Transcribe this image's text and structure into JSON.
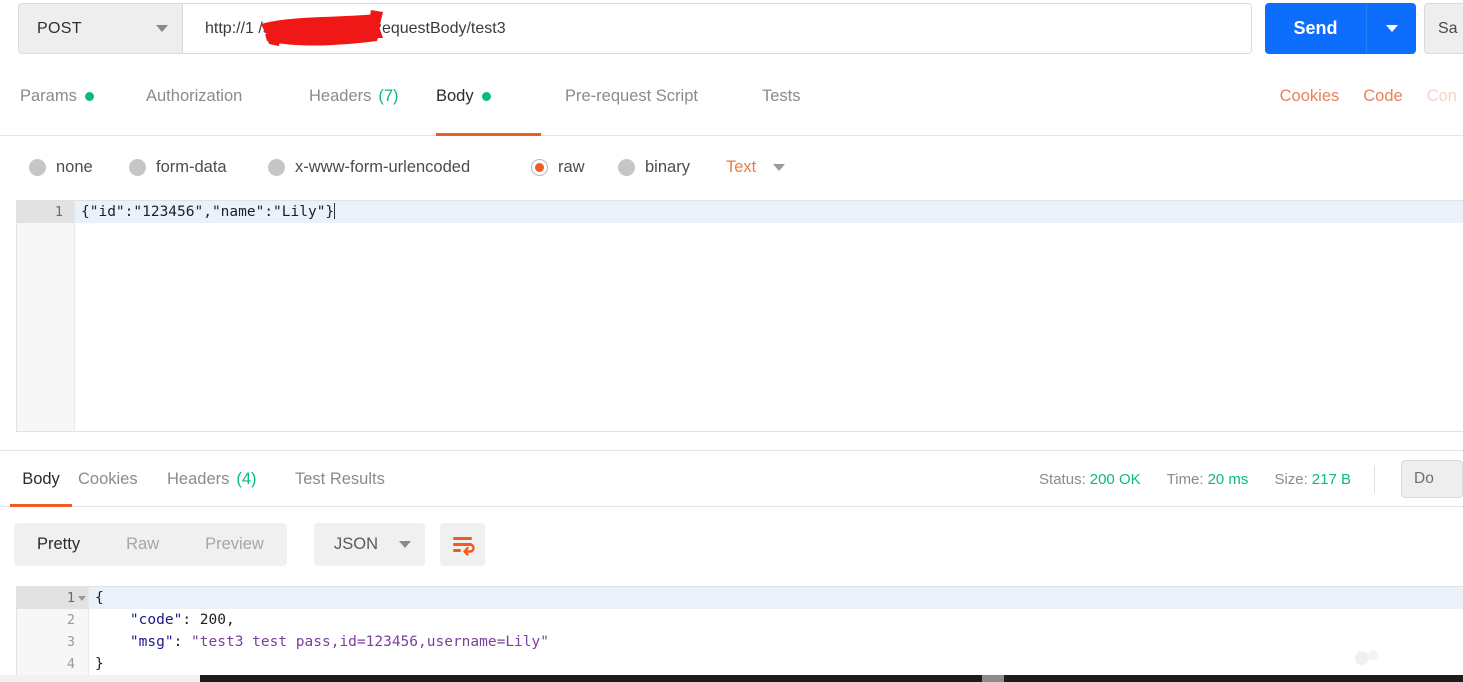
{
  "request": {
    "method": "POST",
    "url_prefix": "http://",
    "url_redacted_placeholder": "",
    "url_suffix": "/springmvc/test/RequestBody/test3",
    "url_full": "http://1          /springmvc/test/RequestBody/test3",
    "send_label": "Send",
    "save_label": "Sa",
    "tabs": [
      {
        "label": "Params",
        "dot": true,
        "count": "",
        "active": false
      },
      {
        "label": "Authorization",
        "dot": false,
        "count": "",
        "active": false
      },
      {
        "label": "Headers",
        "dot": false,
        "count": "(7)",
        "active": false
      },
      {
        "label": "Body",
        "dot": true,
        "count": "",
        "active": true
      },
      {
        "label": "Pre-request Script",
        "dot": false,
        "count": "",
        "active": false
      },
      {
        "label": "Tests",
        "dot": false,
        "count": "",
        "active": false
      }
    ],
    "actions": [
      {
        "label": "Cookies",
        "muted": false
      },
      {
        "label": "Code",
        "muted": false
      },
      {
        "label": "Con",
        "muted": true
      }
    ],
    "body_types": [
      {
        "label": "none",
        "selected": false
      },
      {
        "label": "form-data",
        "selected": false
      },
      {
        "label": "x-www-form-urlencoded",
        "selected": false
      },
      {
        "label": "raw",
        "selected": true
      },
      {
        "label": "binary",
        "selected": false
      }
    ],
    "raw_format": "Text",
    "editor": {
      "line_number": "1",
      "content": "{\"id\":\"123456\",\"name\":\"Lily\"}"
    }
  },
  "response": {
    "tabs": [
      {
        "label": "Body",
        "count": "",
        "active": true
      },
      {
        "label": "Cookies",
        "count": "",
        "active": false
      },
      {
        "label": "Headers",
        "count": "(4)",
        "active": false
      },
      {
        "label": "Test Results",
        "count": "",
        "active": false
      }
    ],
    "meta": {
      "status_label": "Status:",
      "status_value": "200 OK",
      "time_label": "Time:",
      "time_value": "20 ms",
      "size_label": "Size:",
      "size_value": "217 B"
    },
    "download_label": "Do",
    "view_modes": [
      {
        "label": "Pretty",
        "active": true
      },
      {
        "label": "Raw",
        "active": false
      },
      {
        "label": "Preview",
        "active": false
      }
    ],
    "format": "JSON",
    "wrap_icon": "word-wrap-icon",
    "body_lines": [
      {
        "n": "1",
        "fold": true,
        "indent": 0,
        "text": "{"
      },
      {
        "n": "2",
        "fold": false,
        "indent": 1,
        "key": "\"code\"",
        "sep": ": ",
        "num": "200",
        "tail": ","
      },
      {
        "n": "3",
        "fold": false,
        "indent": 1,
        "key": "\"msg\"",
        "sep": ": ",
        "str": "\"test3 test pass,id=123456,username=Lily\"",
        "tail": ""
      },
      {
        "n": "4",
        "fold": false,
        "indent": 0,
        "text": "}"
      }
    ]
  },
  "colors": {
    "accent_orange": "#ef5b25",
    "send_blue": "#0d6efd",
    "status_green": "#0cb97e",
    "redaction_red": "#f01717"
  }
}
